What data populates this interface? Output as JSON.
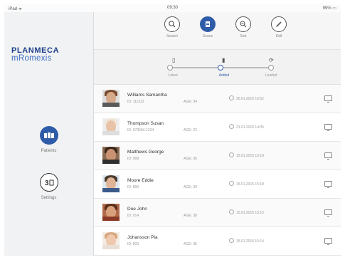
{
  "statusbar": {
    "left": "iPad ᯤ",
    "time": "09:30",
    "battery": "99% ▭"
  },
  "app": {
    "brand_line1": "PLANMECA",
    "brand_line2": "mRomexis"
  },
  "sidebar": {
    "items": [
      {
        "label": "Patients",
        "icon": "patients-icon",
        "active": true
      },
      {
        "label": "Settings",
        "icon": "settings-icon",
        "active": false
      }
    ]
  },
  "toolbar": {
    "tools": [
      {
        "label": "Search",
        "icon": "search-icon",
        "active": false
      },
      {
        "label": "Scans",
        "icon": "scans-icon",
        "active": true
      },
      {
        "label": "Sort",
        "icon": "sort-icon",
        "active": false
      },
      {
        "label": "Edit",
        "icon": "edit-icon",
        "active": false
      }
    ]
  },
  "filter": {
    "options": [
      {
        "label": "Latest",
        "icon": "latest-icon",
        "active": false
      },
      {
        "label": "Added",
        "icon": "added-icon",
        "active": true
      },
      {
        "label": "Loaded",
        "icon": "loaded-icon",
        "active": false
      }
    ],
    "selected_fraction": 0.5
  },
  "patients": [
    {
      "name": "Williams Samantha",
      "id": "ID: 111222",
      "age": "AGE: 34",
      "date": "20.01.2015 10:52"
    },
    {
      "name": "Thompson Susan",
      "id": "ID: 070504-1234",
      "age": "AGE: 22",
      "date": "21.01.2015 14:05"
    },
    {
      "name": "Matthews George",
      "id": "ID: 999",
      "age": "AGE: 36",
      "date": "15.01.2015 15:19"
    },
    {
      "name": "Moore Eddie",
      "id": "ID: 890",
      "age": "AGE: 30",
      "date": "15.01.2015 15:18"
    },
    {
      "name": "Doe John",
      "id": "ID: 014",
      "age": "AGE: 38",
      "date": "15.01.2015 15:15"
    },
    {
      "name": "Johansson Pia",
      "id": "ID: 500",
      "age": "AGE: 35",
      "date": "15.01.2015 15:14"
    }
  ],
  "colors": {
    "accent": "#2f5ca8",
    "brand": "#1b3f8b",
    "sidebar_bg": "#f1f2f3"
  }
}
